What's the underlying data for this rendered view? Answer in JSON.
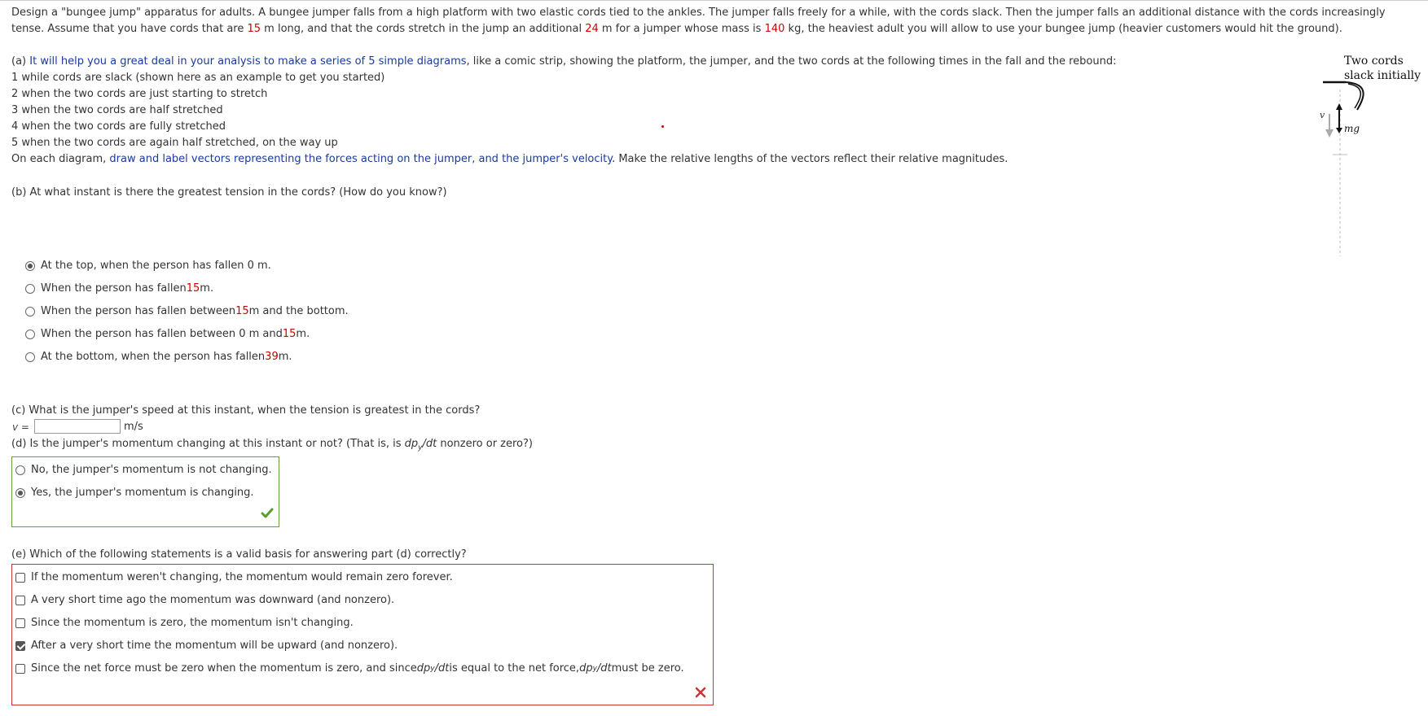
{
  "intro": {
    "line1_a": "Design a \"bungee jump\" apparatus for adults. A bungee jumper falls from a high platform with two elastic cords tied to the ankles. The jumper falls freely for a while, with the cords slack. Then the jumper falls an additional distance with the cords increasingly",
    "line2_a": "tense. Assume that you have cords that are ",
    "cord_length": "15",
    "line2_b": " m long, and that the cords stretch in the jump an additional ",
    "stretch": "24",
    "line2_c": " m for a jumper whose mass is ",
    "mass": "140",
    "line2_d": " kg, the heaviest adult you will allow to use your bungee jump (heavier customers would hit the ground)."
  },
  "part_a": {
    "prefix": "(a) ",
    "link": "It will help you a great deal in your analysis to make a series of 5 simple diagrams",
    "suffix": ", like a comic strip, showing the platform, the jumper, and the two cords at the following times in the fall and the rebound:",
    "items": [
      "1 while cords are slack (shown here as an example to get you started)",
      "2 when the two cords are just starting to stretch",
      "3 when the two cords are half stretched",
      "4 when the two cords are fully stretched",
      "5 when the two cords are again half stretched, on the way up"
    ],
    "diag_prefix": "On each diagram, ",
    "diag_link": "draw and label vectors representing the forces acting on the jumper, and the jumper's velocity",
    "diag_suffix": ". Make the relative lengths of the vectors reflect their relative magnitudes."
  },
  "figure": {
    "caption_line1": "Two cords",
    "caption_line2": "slack initially",
    "v_label": "v",
    "mg_label": "mg"
  },
  "part_b": {
    "question": "(b) At what instant is there the greatest tension in the cords? (How do you know?)",
    "options": [
      {
        "pre": "At the top, when the person has fallen 0 m.",
        "num": "",
        "post": "",
        "selected": true
      },
      {
        "pre": "When the person has fallen ",
        "num": "15",
        "post": " m.",
        "selected": false
      },
      {
        "pre": "When the person has fallen between ",
        "num": "15",
        "post": " m and the bottom.",
        "selected": false
      },
      {
        "pre": "When the person has fallen between 0 m and ",
        "num": "15",
        "post": " m.",
        "selected": false
      },
      {
        "pre": "At the bottom, when the person has fallen ",
        "num": "39",
        "post": " m.",
        "selected": false
      }
    ]
  },
  "part_c": {
    "question": "(c) What is the jumper's speed at this instant, when the tension is greatest in the cords?",
    "var_label": "v =",
    "value": "",
    "unit": "m/s"
  },
  "part_d": {
    "q_pre": "(d) Is the jumper's momentum changing at this instant or not? (That is, is ",
    "q_dp": "dp",
    "q_sub": "y",
    "q_dt": "/dt",
    "q_post": " nonzero or zero?)",
    "options": [
      {
        "label": "No, the jumper's momentum is not changing.",
        "selected": false
      },
      {
        "label": "Yes, the jumper's momentum is changing.",
        "selected": true
      }
    ],
    "status": "correct"
  },
  "part_e": {
    "question": "(e) Which of the following statements is a valid basis for answering part (d) correctly?",
    "options": [
      {
        "label": "If the momentum weren't changing, the momentum would remain zero forever.",
        "checked": false
      },
      {
        "label": "A very short time ago the momentum was downward (and nonzero).",
        "checked": false
      },
      {
        "label": "Since the momentum is zero, the momentum isn't changing.",
        "checked": false
      },
      {
        "label": "After a very short time the momentum will be upward (and nonzero).",
        "checked": true
      }
    ],
    "last_option": {
      "pre": "Since the net force must be zero when the momentum is zero, and since ",
      "dp": "dp",
      "sub": "y",
      "dt": "/dt",
      "mid": " is equal to the net force, ",
      "post": " must be zero.",
      "checked": false
    },
    "status": "incorrect"
  },
  "colors": {
    "red": "#cc0000",
    "blue": "#1a3a9c",
    "correct": "#5a9e2a",
    "incorrect": "#cc3333"
  }
}
